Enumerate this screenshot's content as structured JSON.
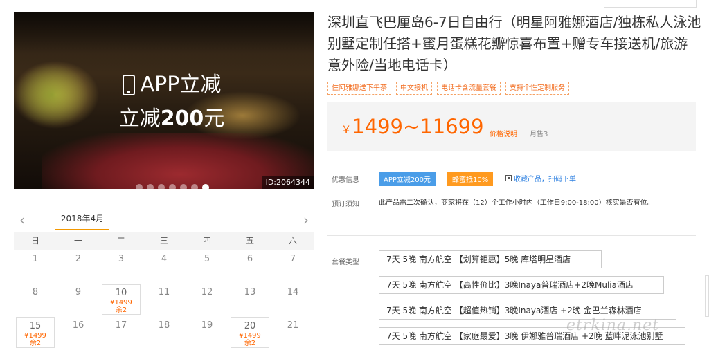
{
  "gallery": {
    "promo_line1": "APP立减",
    "promo_line2_prefix": "立减",
    "promo_line2_amount": "200",
    "promo_line2_suffix": "元",
    "image_id": "ID:2064344",
    "slide_count": 7,
    "active_slide": 7
  },
  "calendar": {
    "month": "2018年4月",
    "prev_icon": "chevron-left-icon",
    "next_icon": "chevron-right-icon",
    "weekdays": [
      "日",
      "一",
      "二",
      "三",
      "四",
      "五",
      "六"
    ],
    "days": [
      {
        "d": "1"
      },
      {
        "d": "2"
      },
      {
        "d": "3"
      },
      {
        "d": "4"
      },
      {
        "d": "5"
      },
      {
        "d": "6"
      },
      {
        "d": "7"
      },
      {
        "d": "8"
      },
      {
        "d": "9"
      },
      {
        "d": "10",
        "price": "¥1499",
        "remain": "余2"
      },
      {
        "d": "11"
      },
      {
        "d": "12"
      },
      {
        "d": "13"
      },
      {
        "d": "14"
      },
      {
        "d": "15",
        "price": "¥1499",
        "remain": "余2"
      },
      {
        "d": "16"
      },
      {
        "d": "17"
      },
      {
        "d": "18"
      },
      {
        "d": "19"
      },
      {
        "d": "20",
        "price": "¥1499",
        "remain": "余2"
      },
      {
        "d": "21"
      }
    ]
  },
  "product": {
    "title": "深圳直飞巴厘岛6-7日自由行（明星阿雅娜酒店/独栋私人泳池别墅定制任搭+蜜月蛋糕花瓣惊喜布置+赠专车接送机/旅游意外险/当地电话卡）",
    "tags": [
      "住阿雅娜送下午茶",
      "中文接机",
      "电话卡含流量套餐",
      "支持个性定制服务"
    ],
    "price_currency": "¥",
    "price_range": "1499~11699",
    "price_note": "价格说明",
    "monthly_sales": "月售3"
  },
  "offers": {
    "label": "优惠信息",
    "app_discount": "APP立减200元",
    "bee_discount": "蜂蜜抵10%",
    "favorite": "收藏产品，扫码下单"
  },
  "booking": {
    "label": "预订须知",
    "text": "此产品需二次确认，商家将在（12）个工作小时内（工作日9:00-18:00）核实是否有位。"
  },
  "packages": {
    "label": "套餐类型",
    "items": [
      "7天 5晚 南方航空 【划算钜惠】5晚 库塔明星酒店",
      "7天 5晚 南方航空 【高性价比】3晚Inaya普瑞酒店+2晚Mulia酒店",
      "7天 5晚 南方航空 【超值热销】3晚Inaya酒店 +2晚 金巴兰森林酒店",
      "7天 5晚 南方航空 【家庭最爱】3晚 伊娜雅普瑞酒店 +2晚 蓝畔泥泳池别墅"
    ]
  },
  "watermark": "etrkina.net",
  "colors": {
    "accent": "#ff6600",
    "blue": "#4a9de8",
    "orange_badge": "#ff9a1f"
  }
}
